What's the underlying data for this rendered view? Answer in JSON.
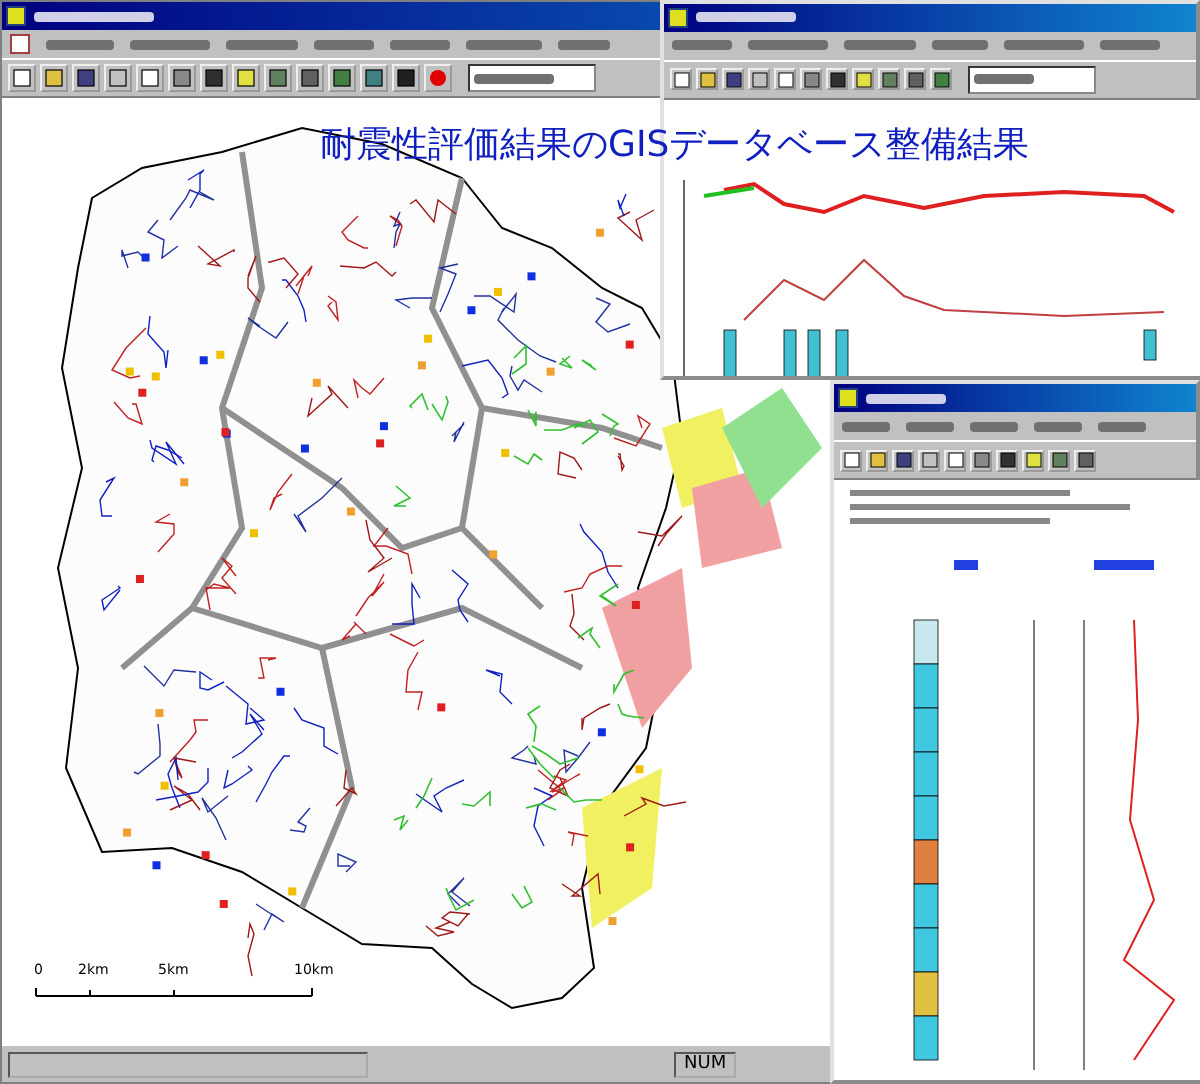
{
  "overlay_title": "耐震性評価結果のGISデータベース整備結果",
  "map": {
    "scale_labels": [
      "0",
      "2km",
      "5km",
      "10km"
    ]
  },
  "status_bar": {
    "indicators": [
      "NUM"
    ]
  },
  "profile_window": {
    "active": true
  },
  "boring_window": {
    "active": true
  }
}
